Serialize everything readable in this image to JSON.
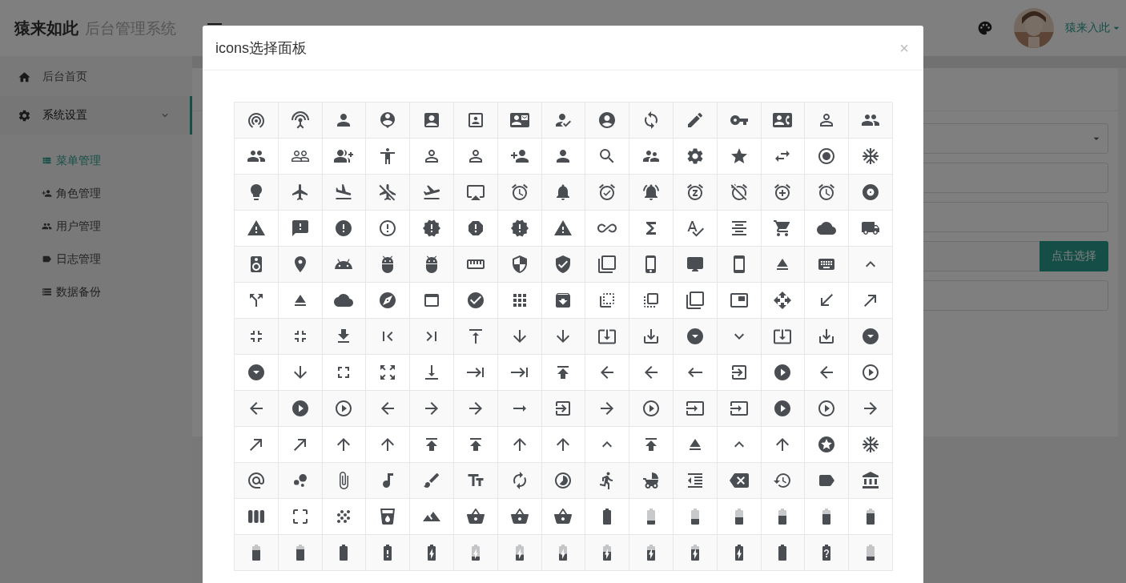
{
  "header": {
    "logo": "猿来如此",
    "system_name": "后台管理系统",
    "user_name": "猿来入此"
  },
  "sidebar": {
    "items": [
      {
        "label": "后台首页",
        "selected": false
      },
      {
        "label": "系统设置",
        "selected": true,
        "expanded": true,
        "children": [
          {
            "label": "菜单管理",
            "selected": true
          },
          {
            "label": "角色管理",
            "selected": false
          },
          {
            "label": "用户管理",
            "selected": false
          },
          {
            "label": "日志管理",
            "selected": false
          },
          {
            "label": "数据备份",
            "selected": false
          }
        ]
      }
    ]
  },
  "form": {
    "rows": [
      {
        "kind": "select"
      },
      {
        "kind": "input"
      },
      {
        "kind": "input"
      },
      {
        "kind": "picker",
        "button": "点击选择"
      },
      {
        "kind": "input"
      }
    ]
  },
  "dialog": {
    "title": "icons选择面板",
    "close": "×"
  }
}
